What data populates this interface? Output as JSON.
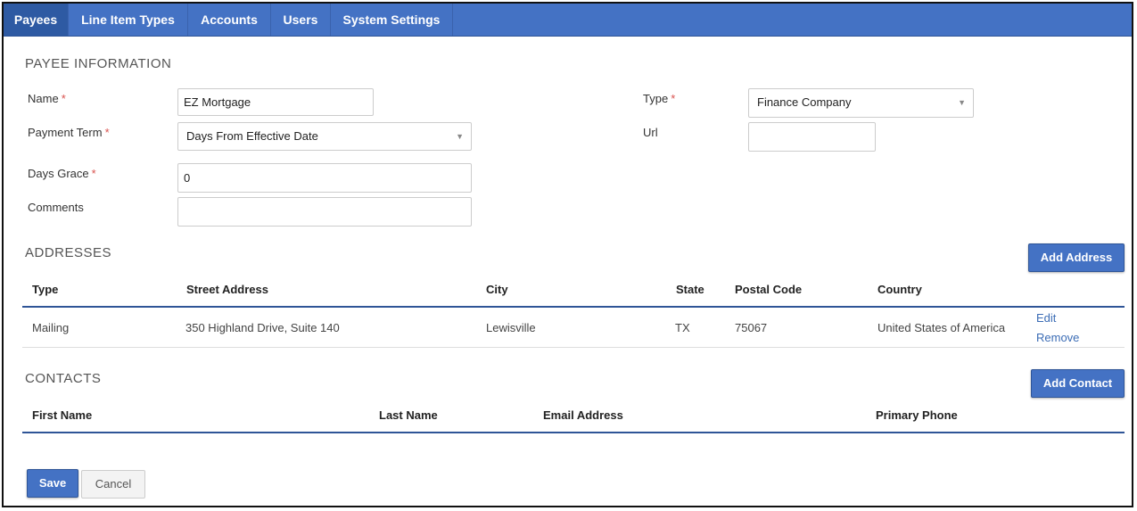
{
  "tabs": [
    {
      "label": "Payees",
      "active": true
    },
    {
      "label": "Line Item Types",
      "active": false
    },
    {
      "label": "Accounts",
      "active": false
    },
    {
      "label": "Users",
      "active": false
    },
    {
      "label": "System Settings",
      "active": false
    }
  ],
  "payee_info": {
    "title": "PAYEE INFORMATION",
    "name_label": "Name",
    "name_value": "EZ Mortgage",
    "payment_term_label": "Payment Term",
    "payment_term_value": "Days From Effective Date",
    "days_grace_label": "Days Grace",
    "days_grace_value": "0",
    "comments_label": "Comments",
    "comments_value": "",
    "type_label": "Type",
    "type_value": "Finance Company",
    "url_label": "Url",
    "url_value": "",
    "required_mark": "*"
  },
  "addresses": {
    "title": "ADDRESSES",
    "add_button": "Add Address",
    "columns": [
      "Type",
      "Street Address",
      "City",
      "State",
      "Postal Code",
      "Country"
    ],
    "rows": [
      {
        "type": "Mailing",
        "street": "350 Highland Drive, Suite 140",
        "city": "Lewisville",
        "state": "TX",
        "postal": "75067",
        "country": "United States of America",
        "edit": "Edit",
        "remove": "Remove"
      }
    ]
  },
  "contacts": {
    "title": "CONTACTS",
    "add_button": "Add Contact",
    "columns": [
      "First Name",
      "Last Name",
      "Email Address",
      "Primary Phone"
    ]
  },
  "footer": {
    "save": "Save",
    "cancel": "Cancel"
  },
  "colors": {
    "brand": "#4472c4",
    "brand_dark": "#2f5597",
    "required": "#d9534f",
    "link": "#3b6cb5"
  }
}
